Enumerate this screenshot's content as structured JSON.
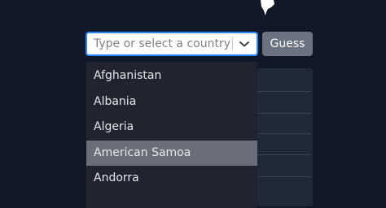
{
  "country_select": {
    "placeholder": "Type or select a country",
    "options": [
      {
        "label": "Afghanistan"
      },
      {
        "label": "Albania"
      },
      {
        "label": "Algeria"
      },
      {
        "label": "American Samoa"
      },
      {
        "label": "Andorra"
      }
    ],
    "focused_option": "American Samoa"
  },
  "guess_button": {
    "label": "Guess"
  },
  "icons": {
    "country_shape": "country-silhouette-icon",
    "dropdown": "chevron-down-icon"
  },
  "colors": {
    "background": "#111827",
    "focus_border": "#2684ff",
    "button": "#6b7280",
    "menu": "#1f2430",
    "option_focused": "#6b6e78"
  }
}
